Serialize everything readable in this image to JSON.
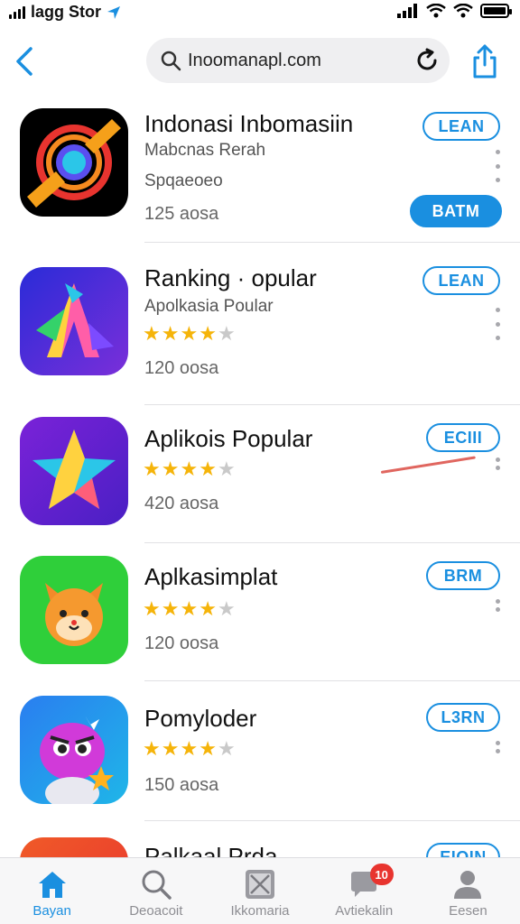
{
  "status_bar": {
    "carrier": "lagg Stor"
  },
  "nav": {
    "search_value": "Inoomanapl.com"
  },
  "apps": [
    {
      "title": "Indonasi Inbomasiin",
      "subtitle": "Mabcnas Rerah",
      "line3": "Spqaeoeo",
      "meta": "125 aosa",
      "button": "LEAN",
      "button2": "BATM",
      "rating": null
    },
    {
      "title": "Ranking · opular",
      "subtitle": "Apolkasia Poular",
      "meta": "120 oosa",
      "button": "LEAN",
      "rating": 4.5
    },
    {
      "title": "Aplikois Popular",
      "subtitle": "",
      "meta": "420 aosa",
      "button": "ECIII",
      "rating": 4.5
    },
    {
      "title": "Aplkasimplat",
      "subtitle": "",
      "meta": "120 oosa",
      "button": "BRM",
      "rating": 4
    },
    {
      "title": "Pomyloder",
      "subtitle": "",
      "meta": "150 aosa",
      "button": "L3RN",
      "rating": 4
    },
    {
      "title": "Palkaal Prda",
      "subtitle": "",
      "meta": "",
      "button": "EIOIN",
      "rating": null
    }
  ],
  "tabs": [
    {
      "label": "Bayan",
      "icon": "home-icon",
      "active": true
    },
    {
      "label": "Deoacoit",
      "icon": "search-icon",
      "active": false
    },
    {
      "label": "Ikkomaria",
      "icon": "apps-icon",
      "active": false
    },
    {
      "label": "Avtiekalin",
      "icon": "chat-icon",
      "active": false,
      "badge": "10"
    },
    {
      "label": "Eesen",
      "icon": "person-icon",
      "active": false
    }
  ],
  "colors": {
    "accent": "#1a8fe0",
    "star": "#f5b40a",
    "badge": "#e8342f"
  }
}
